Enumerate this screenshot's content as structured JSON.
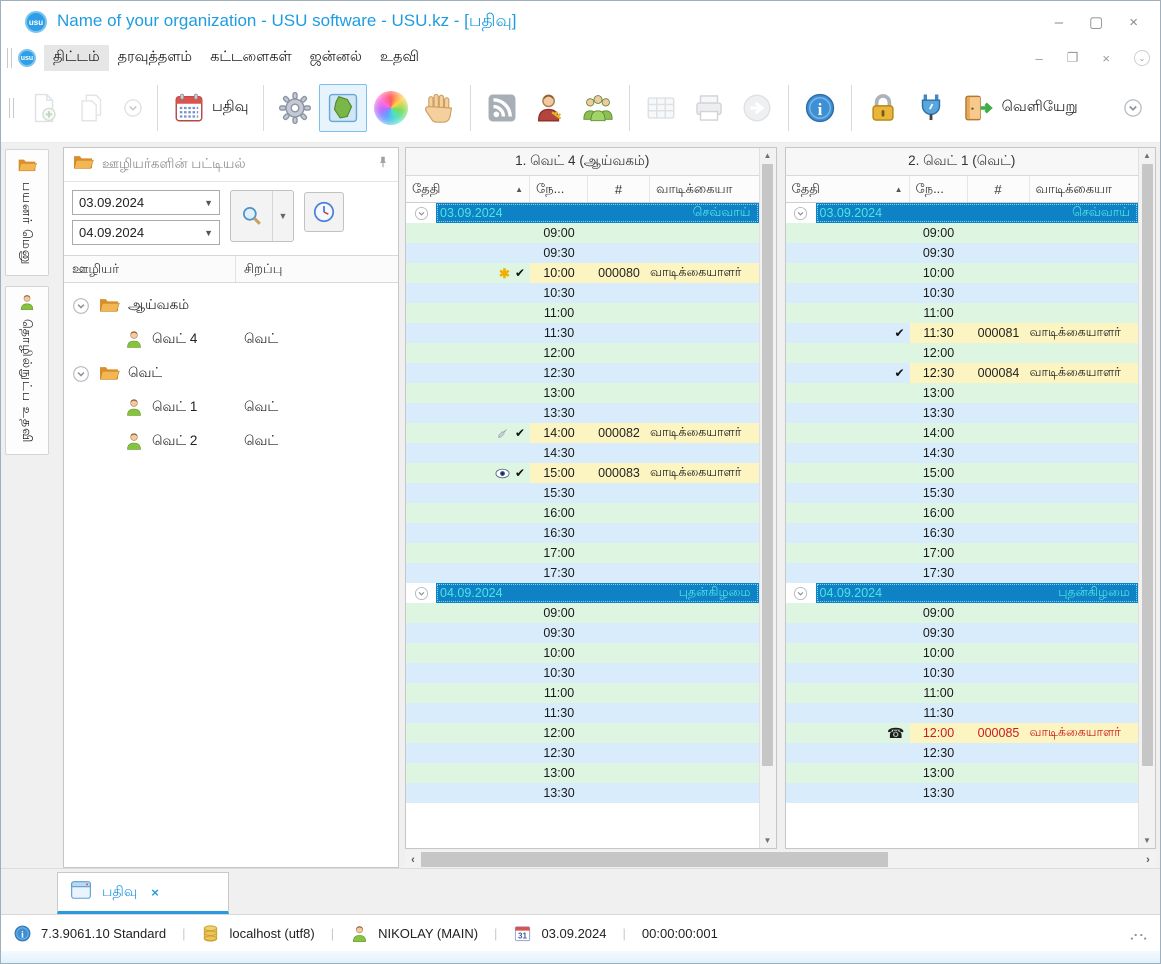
{
  "window": {
    "title": "Name of your organization - USU software - USU.kz - [பதிவு]",
    "logo_text": "usu"
  },
  "menu": {
    "items": [
      "திட்டம்",
      "தரவுத்தளம்",
      "கட்டளைகள்",
      "ஜன்னல்",
      "உதவி"
    ]
  },
  "toolbar": {
    "items": [
      {
        "icon": "newdoc",
        "name": "new-document",
        "enabled": false
      },
      {
        "icon": "copydoc",
        "name": "copy-document",
        "enabled": false
      },
      {
        "icon": "chev",
        "name": "dropdown-chevron",
        "enabled": false,
        "small": true
      },
      {
        "sep": true
      },
      {
        "icon": "calendar",
        "name": "register-calendar",
        "label": "பதிவு",
        "enabled": true
      },
      {
        "sep": true
      },
      {
        "icon": "gear",
        "name": "settings-gear",
        "enabled": true
      },
      {
        "icon": "map",
        "name": "map",
        "enabled": true,
        "selected": true
      },
      {
        "icon": "wheel",
        "name": "color-wheel",
        "enabled": true
      },
      {
        "icon": "hand",
        "name": "hand",
        "enabled": true
      },
      {
        "sep": true
      },
      {
        "icon": "rss",
        "name": "rss-feed",
        "enabled": true
      },
      {
        "icon": "userkey",
        "name": "user-access-key",
        "enabled": true
      },
      {
        "icon": "users",
        "name": "users-group",
        "enabled": true
      },
      {
        "sep": true
      },
      {
        "icon": "grid",
        "name": "table-grid",
        "enabled": false
      },
      {
        "icon": "printer",
        "name": "printer",
        "enabled": false
      },
      {
        "icon": "arrowcirc",
        "name": "forward-arrow",
        "enabled": false
      },
      {
        "sep": true
      },
      {
        "icon": "info",
        "name": "information",
        "enabled": true
      },
      {
        "sep": true
      },
      {
        "icon": "lock",
        "name": "lock",
        "enabled": true
      },
      {
        "icon": "plug",
        "name": "plugin-plug",
        "enabled": true
      },
      {
        "icon": "door",
        "name": "exit-door",
        "label": "வெளியேறு",
        "enabled": true
      },
      {
        "spacer": true
      },
      {
        "icon": "chev",
        "name": "toolbar-overflow-chevron",
        "enabled": true,
        "small": true
      }
    ]
  },
  "side_tabs": [
    {
      "icon": "folder",
      "label": "பயனர் மெனு"
    },
    {
      "icon": "person",
      "label": "தொழில்நுட்ப உதவி"
    }
  ],
  "employee_panel": {
    "title": "ஊழியர்களின் பட்டியல்",
    "date_from": "03.09.2024",
    "date_to": "04.09.2024",
    "columns": [
      "ஊழியர்",
      "சிறப்பு"
    ],
    "tree": [
      {
        "folder": "ஆய்வகம்",
        "children": [
          {
            "name": "வெட் 4",
            "role": "வெட்"
          }
        ]
      },
      {
        "folder": "வெட்",
        "children": [
          {
            "name": "வெட் 1",
            "role": "வெட்"
          },
          {
            "name": "வெட் 2",
            "role": "வெட்"
          }
        ]
      }
    ]
  },
  "schedule": {
    "column_headers": {
      "date": "தேதி",
      "time": "நே...",
      "num": "#",
      "customer": "வாடிக்கையா"
    },
    "panels": [
      {
        "title": "1. வெட் 4 (ஆய்வகம்)",
        "groups": [
          {
            "date": "03.09.2024",
            "weekday": "செவ்வாய்",
            "rows": [
              {
                "time": "09:00"
              },
              {
                "time": "09:30"
              },
              {
                "time": "10:00",
                "number": "000080",
                "customer": "வாடிக்கையாளர்",
                "icons": [
                  "asterisk",
                  "check"
                ]
              },
              {
                "time": "10:30"
              },
              {
                "time": "11:00"
              },
              {
                "time": "11:30"
              },
              {
                "time": "12:00"
              },
              {
                "time": "12:30"
              },
              {
                "time": "13:00"
              },
              {
                "time": "13:30"
              },
              {
                "time": "14:00",
                "number": "000082",
                "customer": "வாடிக்கையாளர்",
                "icons": [
                  "syringe",
                  "check"
                ]
              },
              {
                "time": "14:30"
              },
              {
                "time": "15:00",
                "number": "000083",
                "customer": "வாடிக்கையாளர்",
                "icons": [
                  "eye",
                  "check"
                ]
              },
              {
                "time": "15:30"
              },
              {
                "time": "16:00"
              },
              {
                "time": "16:30"
              },
              {
                "time": "17:00"
              },
              {
                "time": "17:30"
              }
            ]
          },
          {
            "date": "04.09.2024",
            "weekday": "புதன்கிழமை",
            "rows": [
              {
                "time": "09:00"
              },
              {
                "time": "09:30"
              },
              {
                "time": "10:00"
              },
              {
                "time": "10:30"
              },
              {
                "time": "11:00"
              },
              {
                "time": "11:30"
              },
              {
                "time": "12:00"
              },
              {
                "time": "12:30"
              },
              {
                "time": "13:00"
              },
              {
                "time": "13:30"
              }
            ]
          }
        ]
      },
      {
        "title": "2. வெட் 1 (வெட்)",
        "groups": [
          {
            "date": "03.09.2024",
            "weekday": "செவ்வாய்",
            "rows": [
              {
                "time": "09:00"
              },
              {
                "time": "09:30"
              },
              {
                "time": "10:00"
              },
              {
                "time": "10:30"
              },
              {
                "time": "11:00"
              },
              {
                "time": "11:30",
                "number": "000081",
                "customer": "வாடிக்கையாளர்",
                "icons": [
                  "check"
                ]
              },
              {
                "time": "12:00"
              },
              {
                "time": "12:30",
                "number": "000084",
                "customer": "வாடிக்கையாளர்",
                "icons": [
                  "check"
                ]
              },
              {
                "time": "13:00"
              },
              {
                "time": "13:30"
              },
              {
                "time": "14:00"
              },
              {
                "time": "14:30"
              },
              {
                "time": "15:00"
              },
              {
                "time": "15:30"
              },
              {
                "time": "16:00"
              },
              {
                "time": "16:30"
              },
              {
                "time": "17:00"
              },
              {
                "time": "17:30"
              }
            ]
          },
          {
            "date": "04.09.2024",
            "weekday": "புதன்கிழமை",
            "rows": [
              {
                "time": "09:00"
              },
              {
                "time": "09:30"
              },
              {
                "time": "10:00"
              },
              {
                "time": "10:30"
              },
              {
                "time": "11:00"
              },
              {
                "time": "11:30"
              },
              {
                "time": "12:00",
                "number": "000085",
                "customer": "வாடிக்கையாளர்",
                "icons": [
                  "phone"
                ],
                "red": true
              },
              {
                "time": "12:30"
              },
              {
                "time": "13:00"
              },
              {
                "time": "13:30"
              }
            ]
          }
        ]
      }
    ]
  },
  "bottom_tab": {
    "label": "பதிவு",
    "close": "×"
  },
  "statusbar": {
    "items": [
      {
        "icon": "info",
        "name": "version",
        "text": "7.3.9061.10 Standard"
      },
      {
        "icon": "db",
        "name": "database",
        "text": "localhost (utf8)"
      },
      {
        "icon": "person",
        "name": "current-user",
        "text": "NIKOLAY (MAIN)"
      },
      {
        "icon": "cal31",
        "name": "current-date",
        "text": "03.09.2024"
      },
      {
        "icon": null,
        "name": "timer",
        "text": "00:00:00:001"
      }
    ]
  },
  "colors": {
    "accent_blue": "#1f9ce0",
    "group_row_bg": "#0e82c4",
    "group_row_text": "#4fe3e3",
    "row_green": "#def5e2",
    "row_blue": "#d8ecfb",
    "appt_yellow": "#fcf5c1",
    "appt_red_text": "#cc1a1a"
  }
}
